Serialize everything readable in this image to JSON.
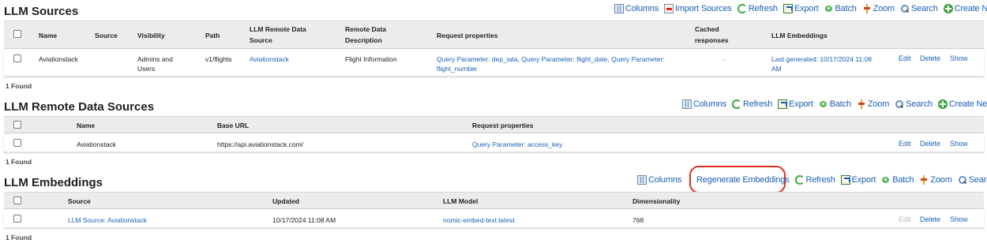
{
  "sources": {
    "title": "LLM Sources",
    "toolbar": {
      "columns": "Columns",
      "import_sources": "Import Sources",
      "refresh": "Refresh",
      "export": "Export",
      "batch": "Batch",
      "zoom": "Zoom",
      "search": "Search",
      "create_new": "Create New"
    },
    "headers": {
      "name": "Name",
      "source": "Source",
      "visibility": "Visibility",
      "path": "Path",
      "remote_line1": "LLM Remote Data",
      "remote_line2": "Source",
      "desc_line1": "Remote Data",
      "desc_line2": "Description",
      "request_props": "Request properties",
      "cached_line1": "Cached",
      "cached_line2": "responses",
      "embeddings": "LLM Embeddings"
    },
    "row": {
      "name": "Aviationstack",
      "source": "",
      "visibility_line1": "Admins and",
      "visibility_line2": "Users",
      "path": "v1/flights",
      "remote": "Aviationstack",
      "description": "Flight Information",
      "props_line1": "Query Parameter: dep_iata, Query Parameter: flight_date, Query Parameter:",
      "props_line2": "flight_number",
      "cached": "-",
      "embeddings_line1": "Last generated: 10/17/2024 11:08",
      "embeddings_line2": "AM",
      "edit": "Edit",
      "delete": "Delete",
      "show": "Show"
    },
    "found": "1 Found"
  },
  "remote": {
    "title": "LLM Remote Data Sources",
    "toolbar": {
      "columns": "Columns",
      "refresh": "Refresh",
      "export": "Export",
      "batch": "Batch",
      "zoom": "Zoom",
      "search": "Search",
      "create_new": "Create New"
    },
    "headers": {
      "name": "Name",
      "base_url": "Base URL",
      "request_props": "Request properties"
    },
    "row": {
      "name": "Aviationstack",
      "base_url": "https://api.aviationstack.com/",
      "props": "Query Parameter: access_key",
      "edit": "Edit",
      "delete": "Delete",
      "show": "Show"
    },
    "found": "1 Found"
  },
  "embeddings": {
    "title": "LLM Embeddings",
    "toolbar": {
      "columns": "Columns",
      "regenerate": "Regenerate Embeddings",
      "refresh": "Refresh",
      "export": "Export",
      "batch": "Batch",
      "zoom": "Zoom",
      "search": "Search"
    },
    "headers": {
      "source": "Source",
      "updated": "Updated",
      "model": "LLM Model",
      "dimensionality": "Dimensionality"
    },
    "row": {
      "source": "LLM Source: Aviationstack",
      "updated": "10/17/2024 11:08 AM",
      "model": "nomic-embed-text:latest",
      "dimensionality": "768",
      "edit": "Edit",
      "delete": "Delete",
      "show": "Show"
    },
    "found": "1 Found"
  },
  "colors": {
    "link": "#1a5fb4",
    "highlight": "#e0301e",
    "header_bg": "#ececec"
  }
}
